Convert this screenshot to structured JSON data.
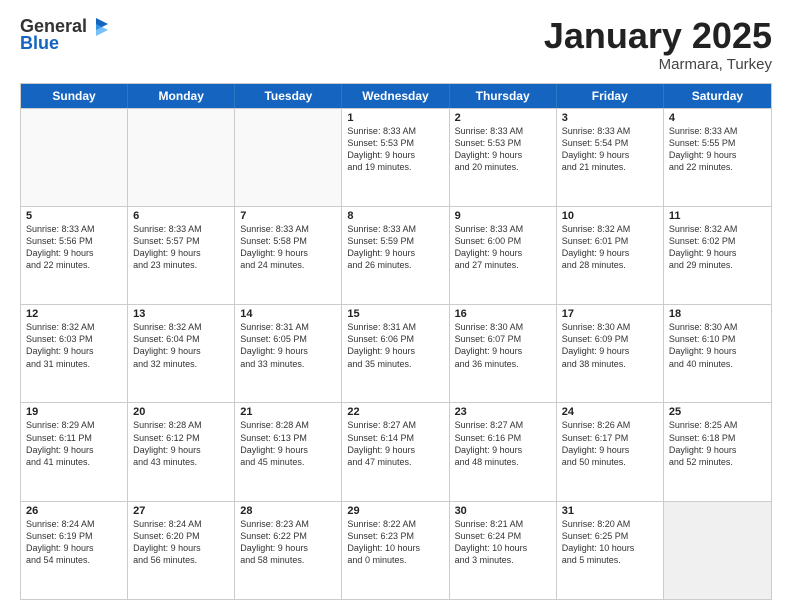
{
  "logo": {
    "general": "General",
    "blue": "Blue"
  },
  "header": {
    "title": "January 2025",
    "subtitle": "Marmara, Turkey"
  },
  "days": [
    "Sunday",
    "Monday",
    "Tuesday",
    "Wednesday",
    "Thursday",
    "Friday",
    "Saturday"
  ],
  "weeks": [
    [
      {
        "day": "",
        "lines": [],
        "empty": true
      },
      {
        "day": "",
        "lines": [],
        "empty": true
      },
      {
        "day": "",
        "lines": [],
        "empty": true
      },
      {
        "day": "1",
        "lines": [
          "Sunrise: 8:33 AM",
          "Sunset: 5:53 PM",
          "Daylight: 9 hours",
          "and 19 minutes."
        ]
      },
      {
        "day": "2",
        "lines": [
          "Sunrise: 8:33 AM",
          "Sunset: 5:53 PM",
          "Daylight: 9 hours",
          "and 20 minutes."
        ]
      },
      {
        "day": "3",
        "lines": [
          "Sunrise: 8:33 AM",
          "Sunset: 5:54 PM",
          "Daylight: 9 hours",
          "and 21 minutes."
        ]
      },
      {
        "day": "4",
        "lines": [
          "Sunrise: 8:33 AM",
          "Sunset: 5:55 PM",
          "Daylight: 9 hours",
          "and 22 minutes."
        ]
      }
    ],
    [
      {
        "day": "5",
        "lines": [
          "Sunrise: 8:33 AM",
          "Sunset: 5:56 PM",
          "Daylight: 9 hours",
          "and 22 minutes."
        ]
      },
      {
        "day": "6",
        "lines": [
          "Sunrise: 8:33 AM",
          "Sunset: 5:57 PM",
          "Daylight: 9 hours",
          "and 23 minutes."
        ]
      },
      {
        "day": "7",
        "lines": [
          "Sunrise: 8:33 AM",
          "Sunset: 5:58 PM",
          "Daylight: 9 hours",
          "and 24 minutes."
        ]
      },
      {
        "day": "8",
        "lines": [
          "Sunrise: 8:33 AM",
          "Sunset: 5:59 PM",
          "Daylight: 9 hours",
          "and 26 minutes."
        ]
      },
      {
        "day": "9",
        "lines": [
          "Sunrise: 8:33 AM",
          "Sunset: 6:00 PM",
          "Daylight: 9 hours",
          "and 27 minutes."
        ]
      },
      {
        "day": "10",
        "lines": [
          "Sunrise: 8:32 AM",
          "Sunset: 6:01 PM",
          "Daylight: 9 hours",
          "and 28 minutes."
        ]
      },
      {
        "day": "11",
        "lines": [
          "Sunrise: 8:32 AM",
          "Sunset: 6:02 PM",
          "Daylight: 9 hours",
          "and 29 minutes."
        ]
      }
    ],
    [
      {
        "day": "12",
        "lines": [
          "Sunrise: 8:32 AM",
          "Sunset: 6:03 PM",
          "Daylight: 9 hours",
          "and 31 minutes."
        ]
      },
      {
        "day": "13",
        "lines": [
          "Sunrise: 8:32 AM",
          "Sunset: 6:04 PM",
          "Daylight: 9 hours",
          "and 32 minutes."
        ]
      },
      {
        "day": "14",
        "lines": [
          "Sunrise: 8:31 AM",
          "Sunset: 6:05 PM",
          "Daylight: 9 hours",
          "and 33 minutes."
        ]
      },
      {
        "day": "15",
        "lines": [
          "Sunrise: 8:31 AM",
          "Sunset: 6:06 PM",
          "Daylight: 9 hours",
          "and 35 minutes."
        ]
      },
      {
        "day": "16",
        "lines": [
          "Sunrise: 8:30 AM",
          "Sunset: 6:07 PM",
          "Daylight: 9 hours",
          "and 36 minutes."
        ]
      },
      {
        "day": "17",
        "lines": [
          "Sunrise: 8:30 AM",
          "Sunset: 6:09 PM",
          "Daylight: 9 hours",
          "and 38 minutes."
        ]
      },
      {
        "day": "18",
        "lines": [
          "Sunrise: 8:30 AM",
          "Sunset: 6:10 PM",
          "Daylight: 9 hours",
          "and 40 minutes."
        ]
      }
    ],
    [
      {
        "day": "19",
        "lines": [
          "Sunrise: 8:29 AM",
          "Sunset: 6:11 PM",
          "Daylight: 9 hours",
          "and 41 minutes."
        ]
      },
      {
        "day": "20",
        "lines": [
          "Sunrise: 8:28 AM",
          "Sunset: 6:12 PM",
          "Daylight: 9 hours",
          "and 43 minutes."
        ]
      },
      {
        "day": "21",
        "lines": [
          "Sunrise: 8:28 AM",
          "Sunset: 6:13 PM",
          "Daylight: 9 hours",
          "and 45 minutes."
        ]
      },
      {
        "day": "22",
        "lines": [
          "Sunrise: 8:27 AM",
          "Sunset: 6:14 PM",
          "Daylight: 9 hours",
          "and 47 minutes."
        ]
      },
      {
        "day": "23",
        "lines": [
          "Sunrise: 8:27 AM",
          "Sunset: 6:16 PM",
          "Daylight: 9 hours",
          "and 48 minutes."
        ]
      },
      {
        "day": "24",
        "lines": [
          "Sunrise: 8:26 AM",
          "Sunset: 6:17 PM",
          "Daylight: 9 hours",
          "and 50 minutes."
        ]
      },
      {
        "day": "25",
        "lines": [
          "Sunrise: 8:25 AM",
          "Sunset: 6:18 PM",
          "Daylight: 9 hours",
          "and 52 minutes."
        ]
      }
    ],
    [
      {
        "day": "26",
        "lines": [
          "Sunrise: 8:24 AM",
          "Sunset: 6:19 PM",
          "Daylight: 9 hours",
          "and 54 minutes."
        ]
      },
      {
        "day": "27",
        "lines": [
          "Sunrise: 8:24 AM",
          "Sunset: 6:20 PM",
          "Daylight: 9 hours",
          "and 56 minutes."
        ]
      },
      {
        "day": "28",
        "lines": [
          "Sunrise: 8:23 AM",
          "Sunset: 6:22 PM",
          "Daylight: 9 hours",
          "and 58 minutes."
        ]
      },
      {
        "day": "29",
        "lines": [
          "Sunrise: 8:22 AM",
          "Sunset: 6:23 PM",
          "Daylight: 10 hours",
          "and 0 minutes."
        ]
      },
      {
        "day": "30",
        "lines": [
          "Sunrise: 8:21 AM",
          "Sunset: 6:24 PM",
          "Daylight: 10 hours",
          "and 3 minutes."
        ]
      },
      {
        "day": "31",
        "lines": [
          "Sunrise: 8:20 AM",
          "Sunset: 6:25 PM",
          "Daylight: 10 hours",
          "and 5 minutes."
        ]
      },
      {
        "day": "",
        "lines": [],
        "empty": true,
        "shaded": true
      }
    ]
  ]
}
